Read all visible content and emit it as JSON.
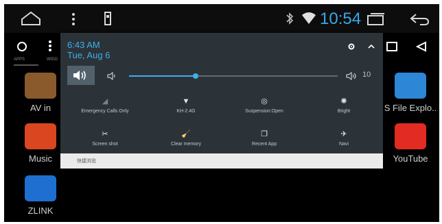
{
  "status_bar": {
    "time": "10:54",
    "icons": [
      "home-icon",
      "more-vert-icon",
      "usb-icon",
      "bluetooth-icon",
      "wifi-icon",
      "recent-apps-icon",
      "back-icon"
    ]
  },
  "launcher": {
    "tabs": [
      "APPS",
      "WIDG"
    ],
    "apps_left": [
      {
        "label": "AV in",
        "color": "#8a5a2c"
      },
      {
        "label": "Music",
        "color": "#d9461f"
      },
      {
        "label": "ZLINK",
        "color": "#1e6fd0"
      }
    ],
    "apps_right": [
      {
        "label": "S File Explo..",
        "color": "#2d86d6"
      },
      {
        "label": "YouTube",
        "color": "#e22b22"
      }
    ]
  },
  "shade": {
    "time": "6:43 AM",
    "date": "Tue, Aug 6",
    "volume": {
      "value": "10",
      "level": 0.32
    },
    "quick_settings": [
      {
        "label": "Emergency Calls Only",
        "icon": "signal-icon",
        "glyph": "◢"
      },
      {
        "label": "KH-2.4G",
        "icon": "wifi-icon",
        "glyph": "▼"
      },
      {
        "label": "Suspension:Open",
        "icon": "target-icon",
        "glyph": "◎"
      },
      {
        "label": "Bright",
        "icon": "brightness-icon",
        "glyph": "✺"
      },
      {
        "label": "Screen shot",
        "icon": "scissors-icon",
        "glyph": "✂"
      },
      {
        "label": "Clear memory",
        "icon": "broom-icon",
        "glyph": "🧹"
      },
      {
        "label": "Recent App",
        "icon": "recent-app-icon",
        "glyph": "❐"
      },
      {
        "label": "Navi",
        "icon": "navi-icon",
        "glyph": "✈"
      }
    ],
    "footer_text": "快捷浏览"
  }
}
